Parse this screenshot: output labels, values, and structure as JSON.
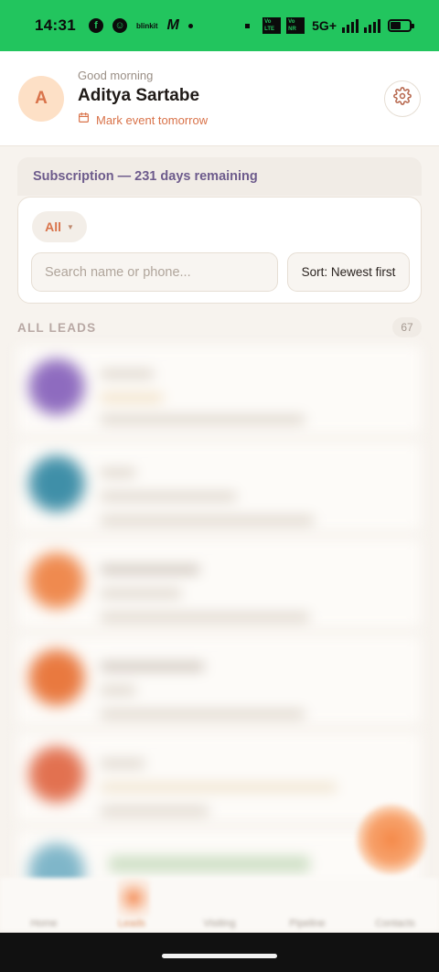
{
  "status_bar": {
    "time": "14:31",
    "network": "5G+",
    "sim1": "Vo LTE",
    "sim2": "Vo NR",
    "app_icons": [
      "facebook-icon",
      "snapchat-icon",
      "blinkit-icon",
      "myntra-icon"
    ]
  },
  "header": {
    "avatar_initial": "A",
    "greeting": "Good morning",
    "user_name": "Aditya Sartabe",
    "event_text": "Mark event tomorrow"
  },
  "subscription": {
    "text": "Subscription — 231 days remaining"
  },
  "filters": {
    "status_chip": "All",
    "search_placeholder": "Search name or phone...",
    "sort_label": "Sort: Newest first"
  },
  "leads": {
    "section_title": "ALL LEADS",
    "count": "67",
    "rows": [
      {
        "avatar_color": "#8e6bbf"
      },
      {
        "avatar_color": "#3f8fa8"
      },
      {
        "avatar_color": "#ef8a4f"
      },
      {
        "avatar_color": "#e9793f"
      },
      {
        "avatar_color": "#e27150"
      },
      {
        "avatar_color": "#7fb6c9"
      }
    ]
  },
  "bottom_nav": {
    "items": [
      "Home",
      "Leads",
      "Visiting",
      "Pipeline",
      "Contacts"
    ],
    "active": "Leads"
  },
  "colors": {
    "status_bar": "#22c55e",
    "accent": "#d9734a",
    "subscription_text": "#6d5b8c"
  }
}
